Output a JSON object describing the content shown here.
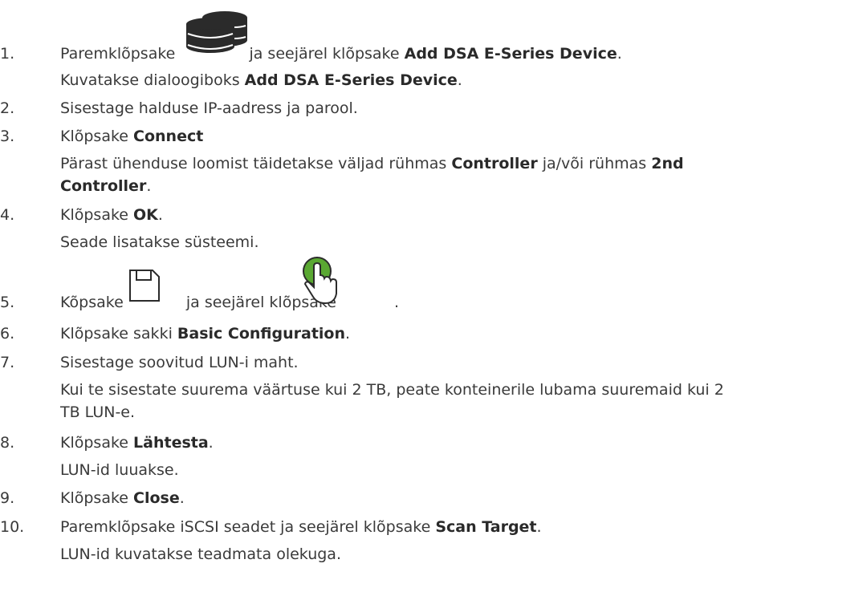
{
  "steps": [
    {
      "num": "1.",
      "line1": {
        "a": "Paremklõpsake",
        "b": "ja seejärel klõpsake",
        "bold": "Add DSA E-Series Device",
        "end": "."
      },
      "line2": {
        "a": "Kuvatakse dialoogiboks",
        "bold": "Add DSA E-Series Device",
        "end": "."
      },
      "icon": "database-stack-icon"
    },
    {
      "num": "2.",
      "text": "Sisestage halduse IP-aadress ja parool."
    },
    {
      "num": "3.",
      "line1": {
        "a": "Klõpsake",
        "bold": "Connect"
      },
      "line2": {
        "a": "Pärast ühenduse loomist täidetakse väljad rühmas",
        "bold1": "Controller",
        "b": "ja/või rühmas",
        "bold2": "2nd"
      },
      "line3": {
        "bold": "Controller",
        "end": "."
      }
    },
    {
      "num": "4.",
      "line1": {
        "a": "Klõpsake",
        "bold": "OK",
        "end": "."
      },
      "line2": "Seade lisatakse süsteemi."
    },
    {
      "num": "5.",
      "a": "Kõpsake",
      "b": "ja seejärel klõpsake",
      "end": ".",
      "icons": [
        "save-icon",
        "green-hand-pointer-icon"
      ]
    },
    {
      "num": "6.",
      "a": "Klõpsake sakki",
      "bold": "Basic Configuration",
      "end": "."
    },
    {
      "num": "7.",
      "line1": "Sisestage soovitud LUN-i maht.",
      "line2": "Kui te sisestate suurema väärtuse kui 2 TB, peate konteinerile lubama suuremaid kui 2",
      "line3": "TB LUN-e."
    },
    {
      "num": "8.",
      "line1": {
        "a": "Klõpsake",
        "bold": "Lähtesta",
        "end": "."
      },
      "line2": "LUN-id luuakse."
    },
    {
      "num": "9.",
      "a": "Klõpsake",
      "bold": "Close",
      "end": "."
    },
    {
      "num": "10.",
      "line1": {
        "a": "Paremklõpsake iSCSI seadet ja seejärel klõpsake",
        "bold": "Scan Target",
        "end": "."
      },
      "line2": "LUN-id kuvatakse teadmata olekuga."
    }
  ],
  "colors": {
    "text": "#3a3a3a",
    "icon_dark": "#2b2b2b",
    "icon_green": "#5aa832"
  }
}
